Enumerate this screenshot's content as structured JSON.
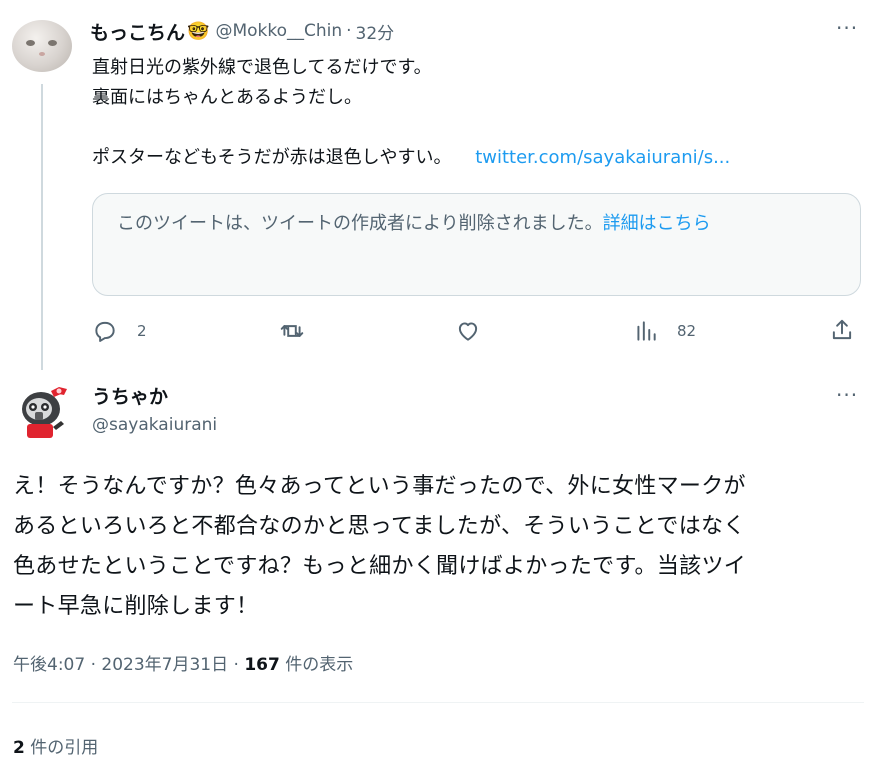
{
  "reply_tweet": {
    "display_name": "もっこちん",
    "emoji": "🤓",
    "handle": "@Mokko__Chin",
    "separator": "·",
    "time": "32分",
    "more": "···",
    "lines": [
      "直射日光の紫外線で退色してるだけです。",
      "裏面にはちゃんとあるようだし。",
      "ポスターなどもそうだが赤は退色しやすい。"
    ],
    "link": "twitter.com/sayakaiurani/s...",
    "deleted_notice": "このツイートは、ツイートの作成者により削除されました。",
    "deleted_link": "詳細はこちら",
    "actions": {
      "reply_count": "2",
      "retweet_count": "",
      "like_count": "",
      "views_count": "82"
    }
  },
  "main_tweet": {
    "display_name": "うちゃか",
    "handle": "@sayakaiurani",
    "more": "···",
    "text_lines": [
      "え！そうなんですか？色々あってという事だったので、外に女性マークが",
      "あるといろいろと不都合なのかと思ってましたが、そういうことではなく",
      "色あせたということですね？もっと細かく聞けばよかったです。当該ツイ",
      "ート早急に削除します！"
    ],
    "timestamp": "午後4:07 · 2023年7月31日 · ",
    "views_number": "167",
    "views_label": " 件の表示",
    "quotes_number": "2",
    "quotes_label": " 件の引用"
  },
  "colors": {
    "accent": "#1d9bf0",
    "secondary_text": "#536471",
    "primary_text": "#0f1419",
    "border": "#cfd9de"
  }
}
